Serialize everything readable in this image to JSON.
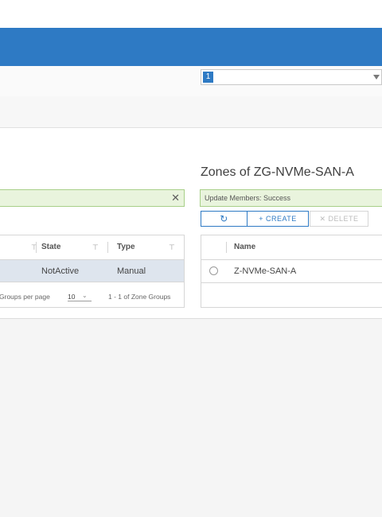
{
  "header": {
    "color": "#2e7ac4"
  },
  "toolbar": {
    "select_badge": "1"
  },
  "zones_panel": {
    "title": "Zones of ZG-NVMe-SAN-A",
    "alert_text": "Update Members: Success",
    "buttons": {
      "refresh_icon": "↻",
      "create_label": "+ CREATE",
      "delete_label": "✕ DELETE"
    },
    "columns": [
      "Name"
    ],
    "rows": [
      {
        "name": "Z-NVMe-SAN-A"
      }
    ]
  },
  "zone_groups_panel": {
    "alert_close_icon": "✕",
    "columns": {
      "state": "State",
      "type": "Type"
    },
    "row": {
      "state": "NotActive",
      "type": "Manual"
    },
    "footer": {
      "per_page_label": "Groups per page",
      "per_page_value": "10",
      "range_text": "1 - 1 of Zone Groups"
    },
    "filter_icon": "⊤"
  }
}
